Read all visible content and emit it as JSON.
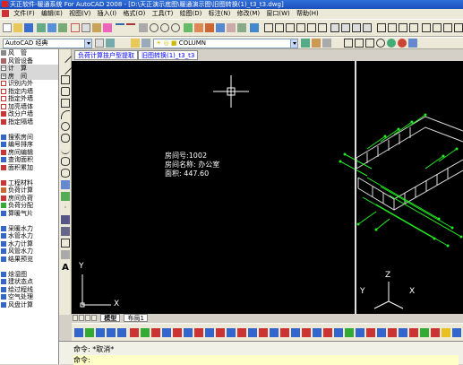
{
  "window": {
    "title": "天正软件-暖通系统 For AutoCAD 2008 - [D:\\天正演示底图\\暖通演示图\\旧图转换(1)_t3_t3.dwg]"
  },
  "menu": [
    "文件(F)",
    "编辑(E)",
    "视图(V)",
    "插入(I)",
    "格式(O)",
    "工具(T)",
    "绘图(D)",
    "标注(N)",
    "修改(M)",
    "窗口(W)",
    "帮助(H)"
  ],
  "toolbar": {
    "workspace": "AutoCAD 经典",
    "layer": "COLUMN"
  },
  "side_panel": {
    "items": [
      {
        "label": "风　管",
        "type": "item"
      },
      {
        "label": "风管设备",
        "type": "item"
      },
      {
        "label": "计　算",
        "type": "header"
      },
      {
        "label": "房　间",
        "type": "header"
      },
      {
        "label": "识别内外",
        "type": "item"
      },
      {
        "label": "指定内墙",
        "type": "item"
      },
      {
        "label": "指定外墙",
        "type": "item"
      },
      {
        "label": "加亮墙体",
        "type": "item"
      },
      {
        "label": "改分户墙",
        "type": "item"
      },
      {
        "label": "指定隔墙",
        "type": "item"
      },
      {
        "label": "",
        "type": "spacer"
      },
      {
        "label": "搜索房间",
        "type": "item"
      },
      {
        "label": "编号排序",
        "type": "item"
      },
      {
        "label": "房间编辑",
        "type": "item"
      },
      {
        "label": "查询面积",
        "type": "item"
      },
      {
        "label": "面积累加",
        "type": "item"
      },
      {
        "label": "",
        "type": "spacer"
      },
      {
        "label": "工程材料",
        "type": "item"
      },
      {
        "label": "负荷计算",
        "type": "item"
      },
      {
        "label": "房间负荷",
        "type": "item"
      },
      {
        "label": "负荷分配",
        "type": "item"
      },
      {
        "label": "算暖气片",
        "type": "item"
      },
      {
        "label": "",
        "type": "spacer"
      },
      {
        "label": "采暖水力",
        "type": "item"
      },
      {
        "label": "水管水力",
        "type": "item"
      },
      {
        "label": "水力计算",
        "type": "item"
      },
      {
        "label": "风管水力",
        "type": "item"
      },
      {
        "label": "结果预览",
        "type": "item"
      },
      {
        "label": "",
        "type": "spacer"
      },
      {
        "label": "焓湿图",
        "type": "item"
      },
      {
        "label": "建状态点",
        "type": "item"
      },
      {
        "label": "绘过程线",
        "type": "item"
      },
      {
        "label": "空气处理",
        "type": "item"
      },
      {
        "label": "风盘计算",
        "type": "item"
      }
    ]
  },
  "doc_tabs": [
    "负荷计算技户型提取",
    "旧图转换(1)_t3_t3"
  ],
  "drawing": {
    "room_info": {
      "line1": "房间号:1002",
      "line2": "房间名称: 办公室",
      "line3": "面积: 447.60"
    },
    "ucs_left": {
      "x": "X",
      "y": "Y"
    },
    "ucs_right": {
      "x": "X",
      "y": "Y",
      "z": "Z"
    }
  },
  "sheet_tabs": [
    "模型",
    "布局1"
  ],
  "command": {
    "line1": "命令: *取消*",
    "line2": "命令:"
  }
}
